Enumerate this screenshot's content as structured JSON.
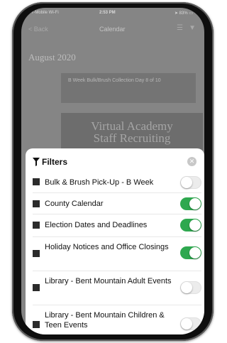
{
  "status_bar": {
    "carrier": "T-Mobile Wi-Fi",
    "time": "2:53 PM",
    "battery": "83%"
  },
  "nav": {
    "back_label": "< Back",
    "title": "Calendar"
  },
  "calendar": {
    "month": "August 2020",
    "event_card": "B Week Bulk/Brush Collection Day 8 of 10",
    "promo_line1": "Virtual Academy",
    "promo_line2": "Staff Recruiting"
  },
  "filters": {
    "title": "Filters",
    "items": [
      {
        "label": "Bulk & Brush Pick-Up - B Week",
        "enabled": false
      },
      {
        "label": "County Calendar",
        "enabled": true
      },
      {
        "label": "Election Dates and Deadlines",
        "enabled": true
      },
      {
        "label": "Holiday Notices and Office Closings",
        "enabled": true
      },
      {
        "label": "Library - Bent Mountain Adult Events",
        "enabled": false
      },
      {
        "label": "Library - Bent Mountain Children & Teen Events",
        "enabled": false
      }
    ]
  },
  "colors": {
    "toggle_on": "#2ea84f",
    "swatch": "#2b2b2b",
    "overlay": "#858585"
  }
}
